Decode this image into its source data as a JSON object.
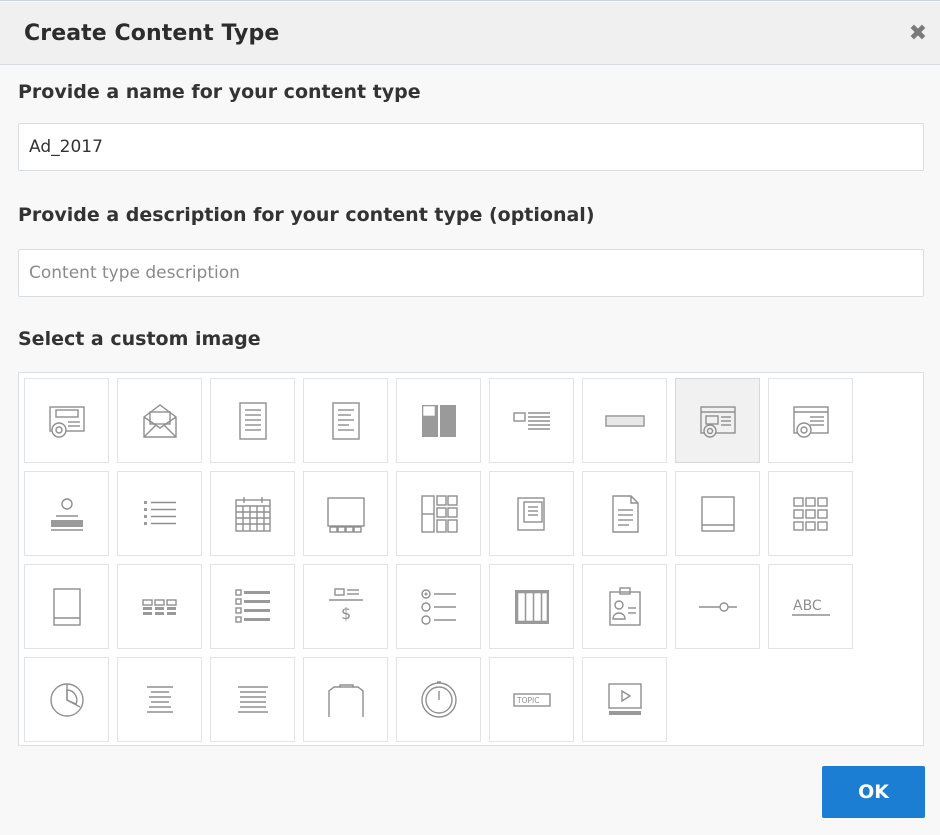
{
  "dialog": {
    "title": "Create Content Type",
    "close_icon": "close-icon"
  },
  "name_section": {
    "label": "Provide a name for your content type",
    "value": "Ad_2017"
  },
  "description_section": {
    "label": "Provide a description for your content type (optional)",
    "value": "",
    "placeholder": "Content type description"
  },
  "image_section": {
    "label": "Select a custom image",
    "selected_index": 7,
    "icons": [
      "media-disc-icon",
      "envelope-icon",
      "document-icon",
      "document-lines-icon",
      "split-panel-icon",
      "image-text-icon",
      "text-field-icon",
      "card-disc-icon",
      "browser-disc-icon",
      "person-stamp-icon",
      "bullet-list-icon",
      "calendar-icon",
      "gallery-strip-icon",
      "tiles-layout-icon",
      "document-stack-icon",
      "file-icon",
      "tablet-icon",
      "grid-icon",
      "page-icon",
      "table-rows-icon",
      "checklist-icon",
      "price-icon",
      "radio-list-icon",
      "columns-icon",
      "id-badge-icon",
      "slider-icon",
      "abc-text-icon",
      "pie-chart-icon",
      "align-center-icon",
      "justify-text-icon",
      "folder-tab-icon",
      "clock-icon",
      "topic-tag-icon",
      "video-player-icon"
    ]
  },
  "footer": {
    "ok_label": "OK"
  }
}
